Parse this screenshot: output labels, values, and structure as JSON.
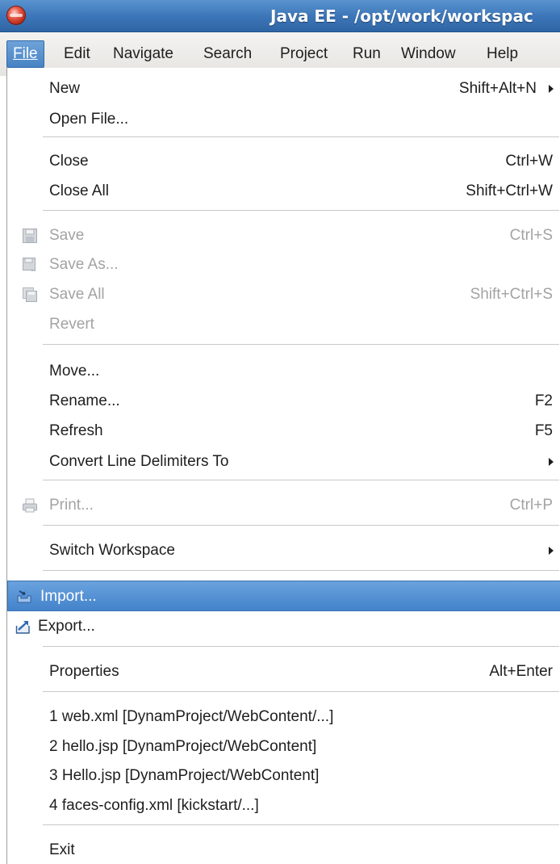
{
  "window": {
    "title": "Java EE - /opt/work/workspac"
  },
  "menubar": {
    "items": [
      "File",
      "Edit",
      "Navigate",
      "Search",
      "Project",
      "Run",
      "Window",
      "Help"
    ],
    "active": "File"
  },
  "file_menu": {
    "new": {
      "label": "New",
      "accel": "Shift+Alt+N"
    },
    "open_file": {
      "label": "Open File..."
    },
    "close": {
      "label": "Close",
      "accel": "Ctrl+W"
    },
    "close_all": {
      "label": "Close All",
      "accel": "Shift+Ctrl+W"
    },
    "save": {
      "label": "Save",
      "accel": "Ctrl+S"
    },
    "save_as": {
      "label": "Save As..."
    },
    "save_all": {
      "label": "Save All",
      "accel": "Shift+Ctrl+S"
    },
    "revert": {
      "label": "Revert"
    },
    "move": {
      "label": "Move..."
    },
    "rename": {
      "label": "Rename...",
      "accel": "F2"
    },
    "refresh": {
      "label": "Refresh",
      "accel": "F5"
    },
    "convert": {
      "label": "Convert Line Delimiters To"
    },
    "print": {
      "label": "Print...",
      "accel": "Ctrl+P"
    },
    "switch_workspace": {
      "label": "Switch Workspace"
    },
    "import": {
      "label": "Import..."
    },
    "export": {
      "label": "Export..."
    },
    "properties": {
      "label": "Properties",
      "accel": "Alt+Enter"
    },
    "recent": [
      "1 web.xml  [DynamProject/WebContent/...]",
      "2 hello.jsp  [DynamProject/WebContent]",
      "3 Hello.jsp  [DynamProject/WebContent]",
      "4 faces-config.xml  [kickstart/...]"
    ],
    "exit": {
      "label": "Exit"
    }
  },
  "colors": {
    "titlebar": "#3d77b9",
    "highlight": "#4a86c8",
    "disabled_text": "#a3a3a3"
  }
}
